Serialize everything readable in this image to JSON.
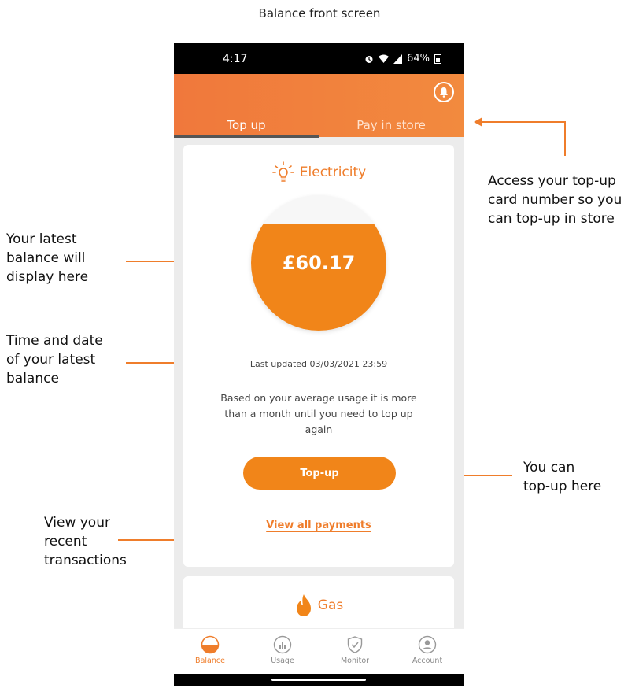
{
  "page_title": "Balance front screen",
  "annotations": {
    "balance_note": [
      "Your latest",
      "balance will",
      "display here"
    ],
    "time_note": [
      "Time and date",
      "of your latest",
      "balance"
    ],
    "transactions_note": [
      "View your",
      "recent",
      "transactions"
    ],
    "store_note": [
      "Access your top-up",
      "card number so you",
      "can top-up in store"
    ],
    "topup_note": [
      "You can",
      "top-up here"
    ]
  },
  "status_bar": {
    "time": "4:17",
    "battery": "64%"
  },
  "header": {
    "tabs": [
      {
        "label": "Top up",
        "selected": true
      },
      {
        "label": "Pay in store",
        "selected": false
      }
    ]
  },
  "electricity": {
    "title": "Electricity",
    "balance": "£60.17",
    "gauge_fill_fraction": 0.79,
    "last_updated": "Last updated 03/03/2021 23:59",
    "usage_message": "Based on your average usage it is more than a month until you need to top up again",
    "topup_label": "Top-up",
    "view_payments_label": "View all payments"
  },
  "gas": {
    "title": "Gas"
  },
  "bottom_nav": [
    {
      "label": "Balance",
      "icon": "balance-icon",
      "active": true
    },
    {
      "label": "Usage",
      "icon": "usage-icon",
      "active": false
    },
    {
      "label": "Monitor",
      "icon": "shield-check-icon",
      "active": false
    },
    {
      "label": "Account",
      "icon": "account-icon",
      "active": false
    }
  ],
  "colors": {
    "accent": "#f18519",
    "header_start": "#f0783c",
    "header_end": "#f28a3e",
    "annotation_arrow": "#ef7d2b"
  }
}
